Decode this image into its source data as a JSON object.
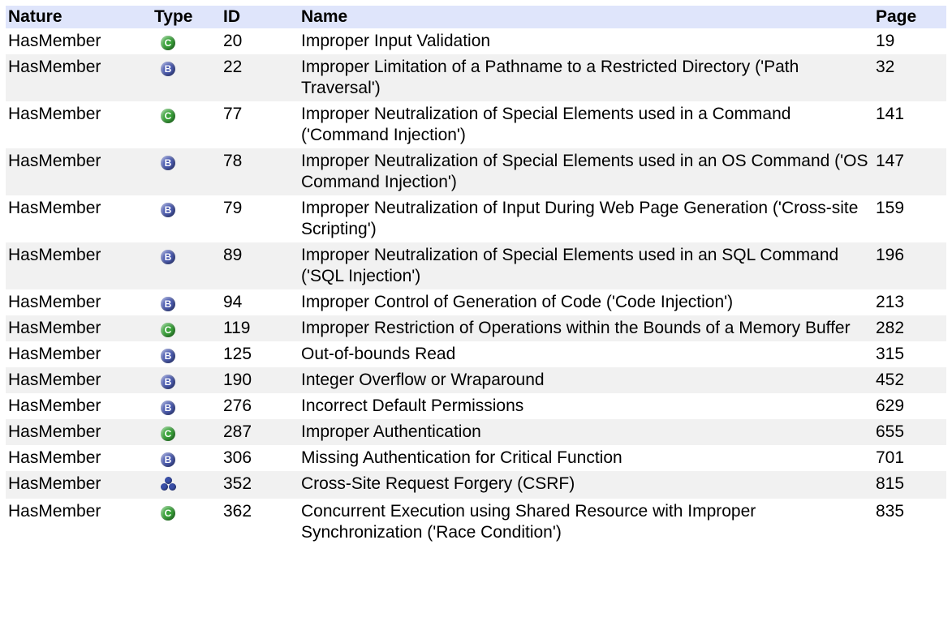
{
  "headers": {
    "nature": "Nature",
    "type": "Type",
    "id": "ID",
    "name": "Name",
    "page": "Page"
  },
  "type_letters": {
    "C": "C",
    "B": "B"
  },
  "colors": {
    "header_bg": "#dfe5fb",
    "row_alt_bg": "#f1f1f1",
    "class_badge": "#3aa33a",
    "base_badge": "#4b5bb0"
  },
  "rows": [
    {
      "nature": "HasMember",
      "type": "class",
      "id": "20",
      "name": "Improper Input Validation",
      "page": "19"
    },
    {
      "nature": "HasMember",
      "type": "base",
      "id": "22",
      "name": "Improper Limitation of a Pathname to a Restricted Directory ('Path Traversal')",
      "page": "32"
    },
    {
      "nature": "HasMember",
      "type": "class",
      "id": "77",
      "name": "Improper Neutralization of Special Elements used in a Command ('Command Injection')",
      "page": "141"
    },
    {
      "nature": "HasMember",
      "type": "base",
      "id": "78",
      "name": "Improper Neutralization of Special Elements used in an OS Command ('OS Command Injection')",
      "page": "147"
    },
    {
      "nature": "HasMember",
      "type": "base",
      "id": "79",
      "name": "Improper Neutralization of Input During Web Page Generation ('Cross-site Scripting')",
      "page": "159"
    },
    {
      "nature": "HasMember",
      "type": "base",
      "id": "89",
      "name": "Improper Neutralization of Special Elements used in an SQL Command ('SQL Injection')",
      "page": "196"
    },
    {
      "nature": "HasMember",
      "type": "base",
      "id": "94",
      "name": "Improper Control of Generation of Code ('Code Injection')",
      "page": "213"
    },
    {
      "nature": "HasMember",
      "type": "class",
      "id": "119",
      "name": "Improper Restriction of Operations within the Bounds of a Memory Buffer",
      "page": "282"
    },
    {
      "nature": "HasMember",
      "type": "base",
      "id": "125",
      "name": "Out-of-bounds Read",
      "page": "315"
    },
    {
      "nature": "HasMember",
      "type": "base",
      "id": "190",
      "name": "Integer Overflow or Wraparound",
      "page": "452"
    },
    {
      "nature": "HasMember",
      "type": "base",
      "id": "276",
      "name": "Incorrect Default Permissions",
      "page": "629"
    },
    {
      "nature": "HasMember",
      "type": "class",
      "id": "287",
      "name": "Improper Authentication",
      "page": "655"
    },
    {
      "nature": "HasMember",
      "type": "base",
      "id": "306",
      "name": "Missing Authentication for Critical Function",
      "page": "701"
    },
    {
      "nature": "HasMember",
      "type": "composite",
      "id": "352",
      "name": "Cross-Site Request Forgery (CSRF)",
      "page": "815"
    },
    {
      "nature": "HasMember",
      "type": "class",
      "id": "362",
      "name": "Concurrent Execution using Shared Resource with Improper Synchronization ('Race Condition')",
      "page": "835"
    }
  ]
}
